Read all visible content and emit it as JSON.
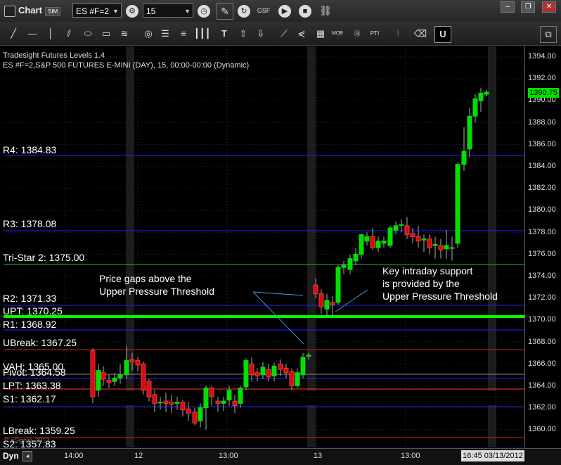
{
  "window": {
    "title": "Chart",
    "badge": "SIM"
  },
  "toolbar": {
    "symbol": "ES #F=2",
    "interval": "15",
    "window_buttons": [
      "",
      "",
      "✕"
    ]
  },
  "chart": {
    "study_name": "Tradesight Futures Levels 1.4",
    "symbol_line": "ES #F=2,S&P 500 FUTURES E-MINI (DAY), 15, 00:00-00:00 (Dynamic)",
    "last_price": "1390.75",
    "y_ticks": [
      "1394.00",
      "1392.00",
      "1390.00",
      "1388.00",
      "1386.00",
      "1384.00",
      "1382.00",
      "1380.00",
      "1378.00",
      "1376.00",
      "1374.00",
      "1372.00",
      "1370.00",
      "1368.00",
      "1366.00",
      "1364.00",
      "1362.00",
      "1360.00"
    ],
    "x_ticks": [
      "14:00",
      "12",
      "13:00",
      "13",
      "13:00"
    ],
    "levels": [
      {
        "label": "R4: 1384.83",
        "color": "#2222ff"
      },
      {
        "label": "R3: 1378.08",
        "color": "#2222ff"
      },
      {
        "label": "Tri-Star 2: 1375.00",
        "color": "#33aa33"
      },
      {
        "label": "R2: 1371.33",
        "color": "#2222ff"
      },
      {
        "label": "UPT: 1370.25",
        "color": "#00ff00"
      },
      {
        "label": "R1: 1368.92",
        "color": "#2222ff"
      },
      {
        "label": "UBreak: 1367.25",
        "color": "#cc2222"
      },
      {
        "label": "VAH: 1365.00",
        "color": "#888888"
      },
      {
        "label": "Pivot: 1364.58",
        "color": "#2222ff"
      },
      {
        "label": "LPT: 1363.38",
        "color": "#ff3333"
      },
      {
        "label": "S1: 1362.17",
        "color": "#2222ff"
      },
      {
        "label": "LBreak: 1359.25",
        "color": "#cc2222"
      },
      {
        "label": "S2: 1357.83",
        "color": "#2222ff"
      }
    ],
    "annotations": [
      {
        "lines": [
          "Price gaps above the",
          "Upper Pressure Threshold"
        ]
      },
      {
        "lines": [
          "Key intraday support",
          "is provided by the",
          "Upper Pressure Threshold"
        ]
      }
    ],
    "watermark": "© eSignal, 2012"
  },
  "status": {
    "mode": "Dyn",
    "datetime": "16:45 03/13/2012"
  }
}
